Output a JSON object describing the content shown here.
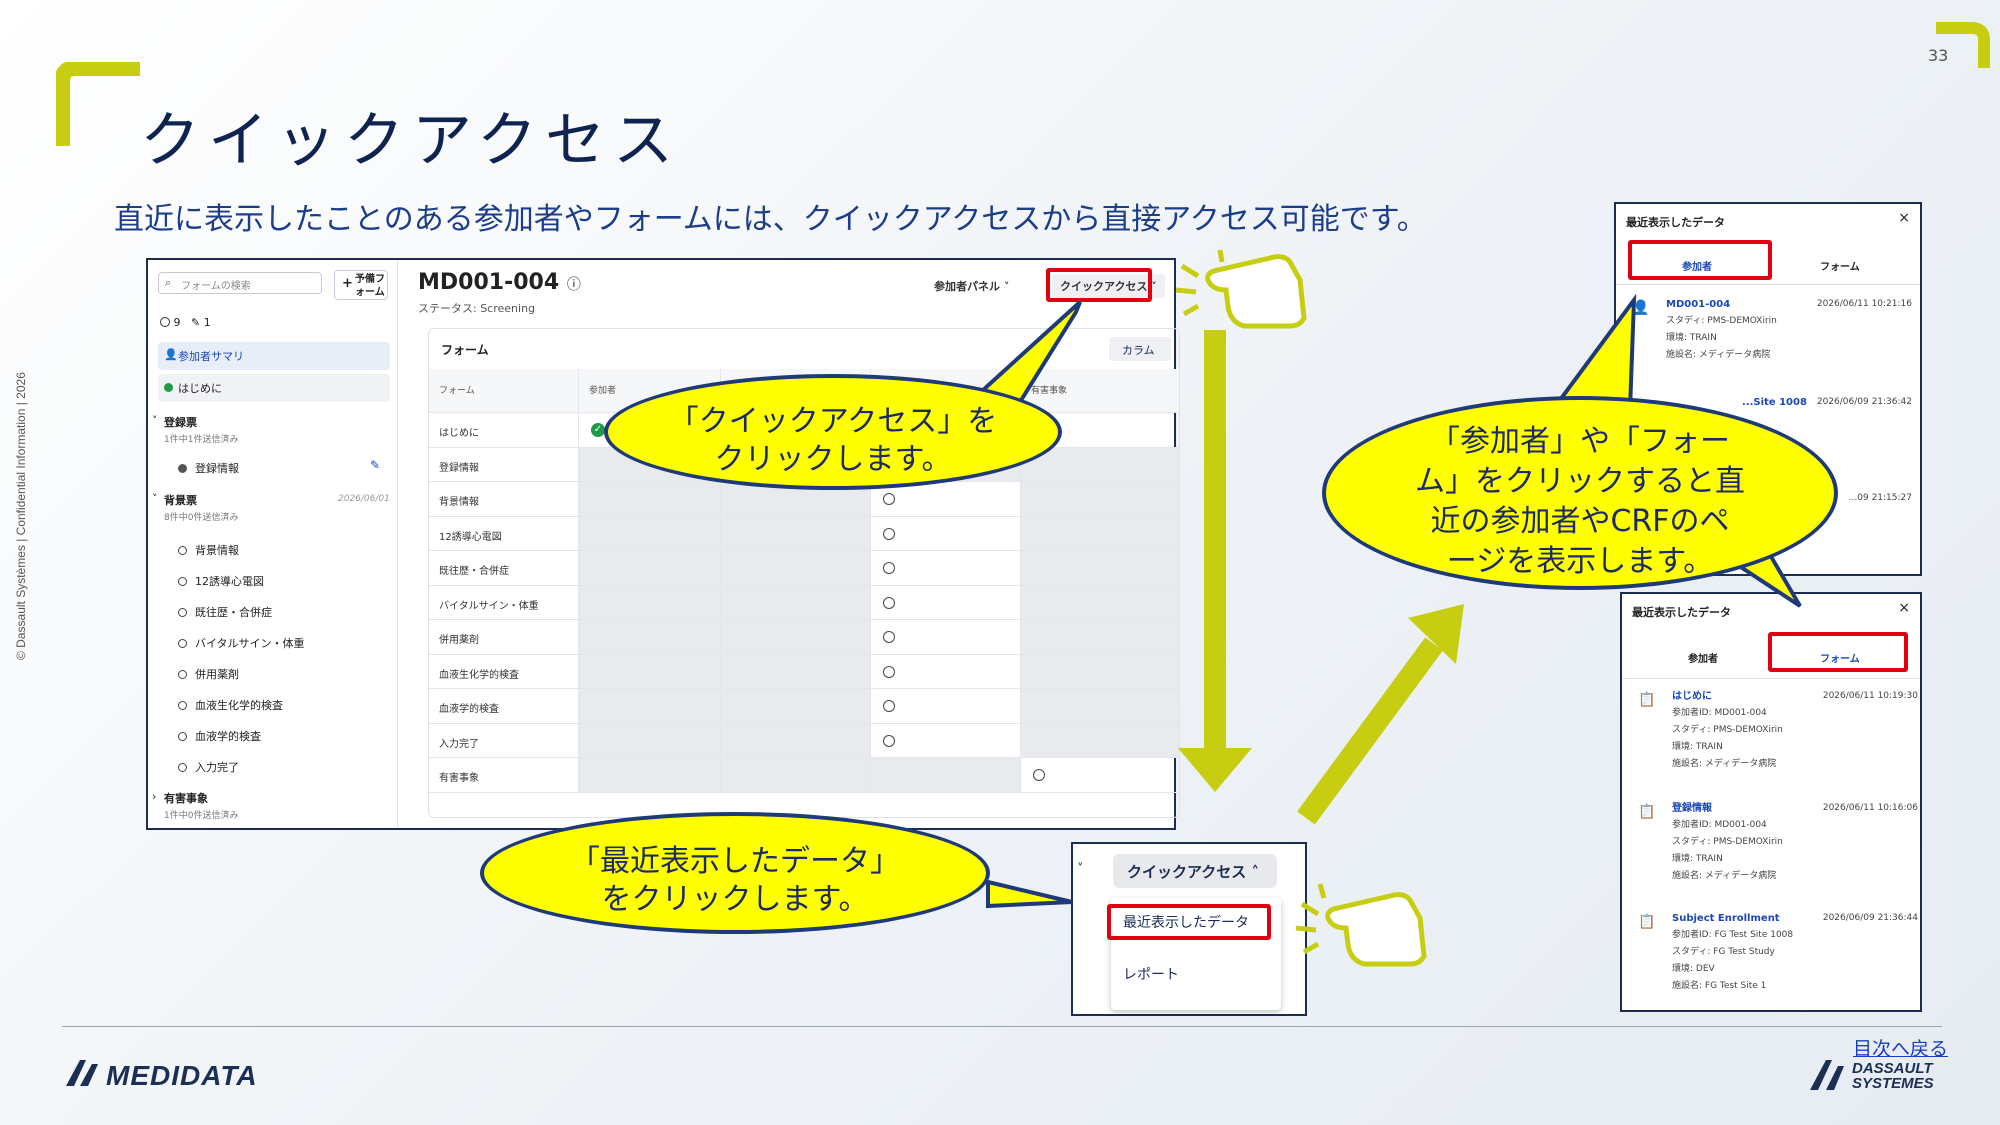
{
  "slide": {
    "page_number": "33",
    "title": "クイックアクセス",
    "subtitle": "直近に表示したことのある参加者やフォームには、クイックアクセスから直接アクセス可能です。",
    "side_text": "© Dassault Systèmes | Confidential Information | 2026",
    "toc_link": "目次へ戻る",
    "logo_left": "MEDIDATA",
    "logo_right_1": "DASSAULT",
    "logo_right_2": "SYSTEMES",
    "accent_color": "#c7ce12"
  },
  "app": {
    "search_placeholder": "フォームの検索",
    "new_form_label_1": "予備フ",
    "new_form_label_2": "ォーム",
    "count_open": "9",
    "count_edit": "1",
    "nav_summary": "参加者サマリ",
    "nav_intro": "はじめに",
    "groups": [
      {
        "name": "登録票",
        "sub": "1件中1件送信済み",
        "date": ""
      },
      {
        "name": "背景票",
        "sub": "8件中0件送信済み",
        "date": "2026/06/01"
      },
      {
        "name": "有害事象",
        "sub": "1件中0件送信済み",
        "date": ""
      }
    ],
    "reg_leaf": "登録情報",
    "bg_leaves": [
      "背景情報",
      "12誘導心電図",
      "既往歴・合併症",
      "バイタルサイン・体重",
      "併用薬剤",
      "血液生化学的検査",
      "血液学的検査",
      "入力完了"
    ],
    "subject_id": "MD001-004",
    "status": "ステータス: Screening",
    "participant_panel": "参加者パネル ˅",
    "quick_access": "クイックアクセス ˅",
    "grid_title": "フォーム",
    "column_button": "カラム",
    "col_headers": [
      "フォーム",
      "参加者",
      "",
      "",
      "有害事象"
    ],
    "rows": [
      "はじめに",
      "登録情報",
      "背景情報",
      "12誘導心電図",
      "既往歴・合併症",
      "バイタルサイン・体重",
      "併用薬剤",
      "血液生化学的検査",
      "血液学的検査",
      "入力完了",
      "有害事象"
    ]
  },
  "callouts": {
    "c1": [
      "「クイックアクセス」を",
      "クリックします。"
    ],
    "c2": [
      "「最近表示したデータ」",
      "をクリックします。"
    ],
    "c3": [
      "「参加者」や「フォー",
      "ム」をクリックすると直",
      "近の参加者やCRFのペ",
      "ージを表示します。"
    ]
  },
  "quick_menu": {
    "header": "クイックアクセス ˄",
    "item_recent": "最近表示したデータ",
    "item_report": "レポート"
  },
  "recent_top": {
    "title": "最近表示したデータ",
    "tab_participant": "参加者",
    "tab_form": "フォーム",
    "items": [
      {
        "name": "MD001-004",
        "date": "2026/06/11 10:21:16",
        "lines": [
          "スタディ: PMS-DEMOXirin",
          "環境: TRAIN",
          "施設名: メディデータ病院"
        ]
      },
      {
        "name": "...Site 1008",
        "date": "2026/06/09 21:36:42",
        "lines": []
      },
      {
        "name": "",
        "date": "...09 21:15:27",
        "lines": []
      }
    ]
  },
  "recent_bottom": {
    "title": "最近表示したデータ",
    "tab_participant": "参加者",
    "tab_form": "フォーム",
    "items": [
      {
        "name": "はじめに",
        "date": "2026/06/11 10:19:30",
        "lines": [
          "参加者ID: MD001-004",
          "スタディ: PMS-DEMOXirin",
          "環境: TRAIN",
          "施設名: メディデータ病院"
        ]
      },
      {
        "name": "登録情報",
        "date": "2026/06/11 10:16:06",
        "lines": [
          "参加者ID: MD001-004",
          "スタディ: PMS-DEMOXirin",
          "環境: TRAIN",
          "施設名: メディデータ病院"
        ]
      },
      {
        "name": "Subject Enrollment",
        "date": "2026/06/09 21:36:44",
        "lines": [
          "参加者ID: FG Test Site 1008",
          "スタディ: FG Test Study",
          "環境: DEV",
          "施設名: FG Test Site 1"
        ]
      }
    ]
  }
}
